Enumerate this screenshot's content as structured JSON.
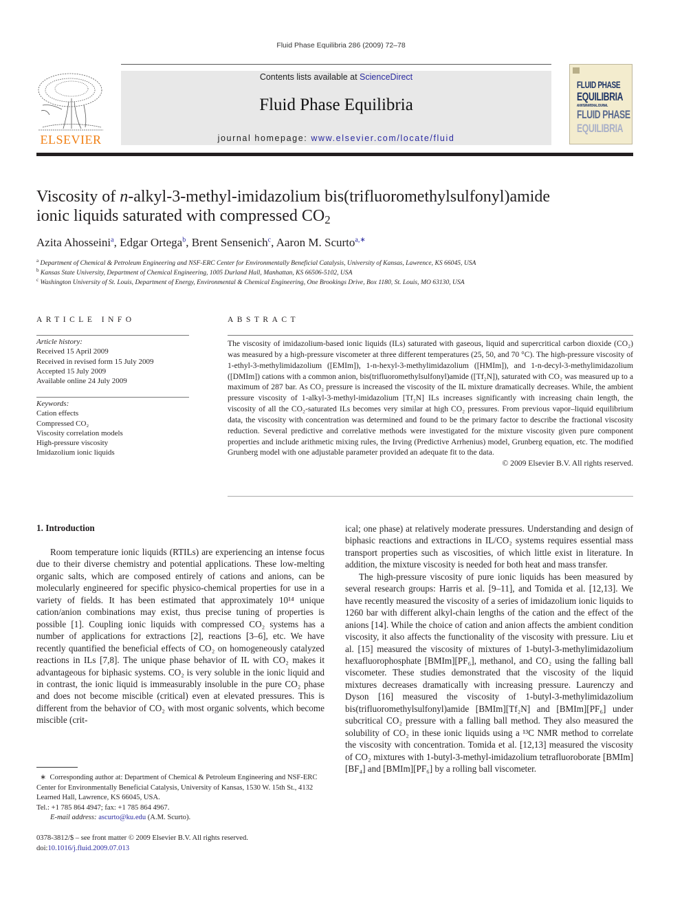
{
  "header": {
    "running_head": "Fluid Phase Equilibria 286 (2009) 72–78",
    "contents_prefix": "Contents lists available at ",
    "contents_link": "ScienceDirect",
    "journal_title": "Fluid Phase Equilibria",
    "homepage_prefix": "journal homepage: ",
    "homepage_url": "www.elsevier.com/locate/fluid",
    "publisher_logo_text": "ELSEVIER",
    "cover_lines": [
      "FLUID PHASE",
      "EQUILIBRIA",
      "AN INTERNATIONAL JOURNAL",
      "FLUID PHASE",
      "EQUILIBRIA"
    ],
    "colors": {
      "publisher_orange": "#f07f13",
      "link_blue": "#2a2aa0",
      "cover_bg": "#f3ecce",
      "cover_navy": "#1f3566"
    }
  },
  "article": {
    "title_part1": "Viscosity of ",
    "title_italic": "n",
    "title_part2": "-alkyl-3-methyl-imidazolium bis(trifluoromethylsulfonyl)amide",
    "title_line2": "ionic liquids saturated with compressed CO",
    "title_sub": "2",
    "authors": [
      {
        "name": "Azita Ahosseini",
        "aff": "a",
        "sep": ", "
      },
      {
        "name": "Edgar Ortega",
        "aff": "b",
        "sep": ", "
      },
      {
        "name": "Brent Sensenich",
        "aff": "c",
        "sep": ", "
      },
      {
        "name": "Aaron M. Scurto",
        "aff": "a,∗",
        "sep": ""
      }
    ],
    "affiliations": [
      {
        "key": "a",
        "text": "Department of Chemical & Petroleum Engineering and NSF-ERC Center for Environmentally Beneficial Catalysis, University of Kansas, Lawrence, KS 66045, USA"
      },
      {
        "key": "b",
        "text": "Kansas State University, Department of Chemical Engineering, 1005 Durland Hall, Manhattan, KS 66506-5102, USA"
      },
      {
        "key": "c",
        "text": "Washington University of St. Louis, Department of Energy, Environmental & Chemical Engineering, One Brookings Drive, Box 1180, St. Louis, MO 63130, USA"
      }
    ]
  },
  "article_info": {
    "heading": "ARTICLE INFO",
    "history_label": "Article history:",
    "history": [
      "Received 15 April 2009",
      "Received in revised form 15 July 2009",
      "Accepted 15 July 2009",
      "Available online 24 July 2009"
    ],
    "keywords_label": "Keywords:",
    "keywords": [
      "Cation effects",
      "Compressed CO₂",
      "Viscosity correlation models",
      "High-pressure viscosity",
      "Imidazolium ionic liquids"
    ]
  },
  "abstract": {
    "heading": "ABSTRACT",
    "text": "The viscosity of imidazolium-based ionic liquids (ILs) saturated with gaseous, liquid and supercritical carbon dioxide (CO₂) was measured by a high-pressure viscometer at three different temperatures (25, 50, and 70 °C). The high-pressure viscosity of 1-ethyl-3-methylimidazolium ([EMIm]), 1-n-hexyl-3-methylimidazolium ([HMIm]), and 1-n-decyl-3-methylimidazolium ([DMIm]) cations with a common anion, bis(trifluoromethylsulfonyl)amide ([Tf₂N]), saturated with CO₂ was measured up to a maximum of 287 bar. As CO₂ pressure is increased the viscosity of the IL mixture dramatically decreases. While, the ambient pressure viscosity of 1-alkyl-3-methyl-imidazolium [Tf₂N] ILs increases significantly with increasing chain length, the viscosity of all the CO₂-saturated ILs becomes very similar at high CO₂ pressures. From previous vapor–liquid equilibrium data, the viscosity with concentration was determined and found to be the primary factor to describe the fractional viscosity reduction. Several predictive and correlative methods were investigated for the mixture viscosity given pure component properties and include arithmetic mixing rules, the Irving (Predictive Arrhenius) model, Grunberg equation, etc. The modified Grunberg model with one adjustable parameter provided an adequate fit to the data.",
    "copyright": "© 2009 Elsevier B.V. All rights reserved."
  },
  "introduction": {
    "heading": "1.  Introduction",
    "left_p1": "Room temperature ionic liquids (RTILs) are experiencing an intense focus due to their diverse chemistry and potential applications. These low-melting organic salts, which are composed entirely of cations and anions, can be molecularly engineered for specific physico-chemical properties for use in a variety of fields. It has been estimated that approximately 10¹⁴ unique cation/anion combinations may exist, thus precise tuning of properties is possible [1]. Coupling ionic liquids with compressed CO₂ systems has a number of applications for extractions [2], reactions [3–6], etc. We have recently quantified the beneficial effects of CO₂ on homogeneously catalyzed reactions in ILs [7,8]. The unique phase behavior of IL with CO₂ makes it advantageous for biphasic systems. CO₂ is very soluble in the ionic liquid and in contrast, the ionic liquid is immeasurably insoluble in the pure CO₂ phase and does not become miscible (critical) even at elevated pressures. This is different from the behavior of CO₂ with most organic solvents, which become miscible (crit-",
    "right_p1": "ical; one phase) at relatively moderate pressures. Understanding and design of biphasic reactions and extractions in IL/CO₂ systems requires essential mass transport properties such as viscosities, of which little exist in literature. In addition, the mixture viscosity is needed for both heat and mass transfer.",
    "right_p2": "The high-pressure viscosity of pure ionic liquids has been measured by several research groups: Harris et al. [9–11], and Tomida et al. [12,13]. We have recently measured the viscosity of a series of imidazolium ionic liquids to 1260 bar with different alkyl-chain lengths of the cation and the effect of the anions [14]. While the choice of cation and anion affects the ambient condition viscosity, it also affects the functionality of the viscosity with pressure. Liu et al. [15] measured the viscosity of mixtures of 1-butyl-3-methylimidazolium hexafluorophosphate [BMIm][PF₆], methanol, and CO₂ using the falling ball viscometer. These studies demonstrated that the viscosity of the liquid mixtures decreases dramatically with increasing pressure. Laurenczy and Dyson [16] measured the viscosity of 1-butyl-3-methylimidazolium bis(trifluoromethylsulfonyl)amide [BMIm][Tf₂N] and [BMIm][PF₆] under subcritical CO₂ pressure with a falling ball method. They also measured the solubility of CO₂ in these ionic liquids using a ¹³C NMR method to correlate the viscosity with concentration. Tomida et al. [12,13] measured the viscosity of CO₂ mixtures with 1-butyl-3-methyl-imidazolium tetrafluoroborate [BMIm][BF₄] and [BMIm][PF₆] by a rolling ball viscometer."
  },
  "footnote": {
    "marker": "∗",
    "text": "Corresponding author at: Department of Chemical & Petroleum Engineering and NSF-ERC Center for Environmentally Beneficial Catalysis, University of Kansas, 1530 W. 15th St., 4132 Learned Hall, Lawrence, KS 66045, USA.",
    "tel": "Tel.: +1 785 864 4947; fax: +1 785 864 4967.",
    "email_label": "E-mail address: ",
    "email": "ascurto@ku.edu",
    "email_suffix": " (A.M. Scurto)."
  },
  "front_matter": {
    "issn_line": "0378-3812/$ – see front matter © 2009 Elsevier B.V. All rights reserved.",
    "doi_label": "doi:",
    "doi": "10.1016/j.fluid.2009.07.013"
  }
}
